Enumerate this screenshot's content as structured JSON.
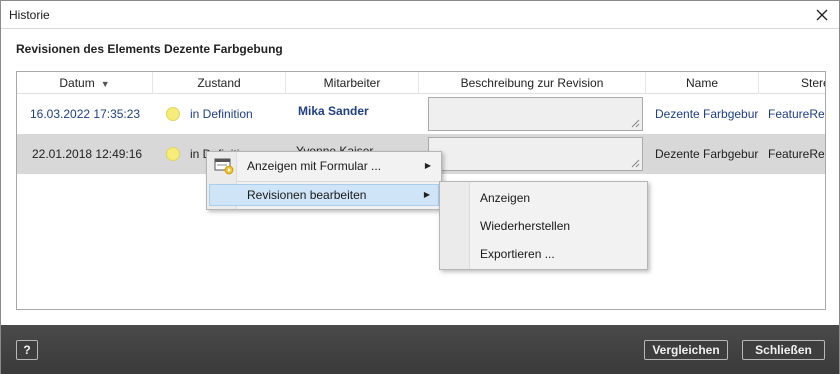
{
  "window": {
    "title": "Historie"
  },
  "heading": "Revisionen des Elements Dezente Farbgebung",
  "columns": {
    "datum": "Datum",
    "zustand": "Zustand",
    "mitarbeiter": "Mitarbeiter",
    "beschreibung": "Beschreibung zur Revision",
    "name": "Name",
    "stereo": "Stere"
  },
  "rows": [
    {
      "datum": "16.03.2022 17:35:23",
      "zustand": "in Definition",
      "mitarbeiter": "Mika Sander",
      "name": "Dezente Farbgebur",
      "stereo": "FeatureRe"
    },
    {
      "datum": "22.01.2018 12:49:16",
      "zustand": "in Definition",
      "mitarbeiter": "Yvonne Kaiser",
      "name": "Dezente Farbgebur",
      "stereo": "FeatureRe"
    }
  ],
  "context_menu": {
    "items": [
      "Anzeigen mit Formular ...",
      "Revisionen bearbeiten"
    ]
  },
  "submenu": {
    "items": [
      "Anzeigen",
      "Wiederherstellen",
      "Exportieren ..."
    ]
  },
  "footer": {
    "help": "?",
    "compare": "Vergleichen",
    "close": "Schließen"
  },
  "colors": {
    "link": "#1f3f86",
    "selected_row": "#d8d8d8",
    "status_dot": "#f5ec7a",
    "footer_bg": "#404040",
    "menu_hover": "#cfe4f6"
  }
}
